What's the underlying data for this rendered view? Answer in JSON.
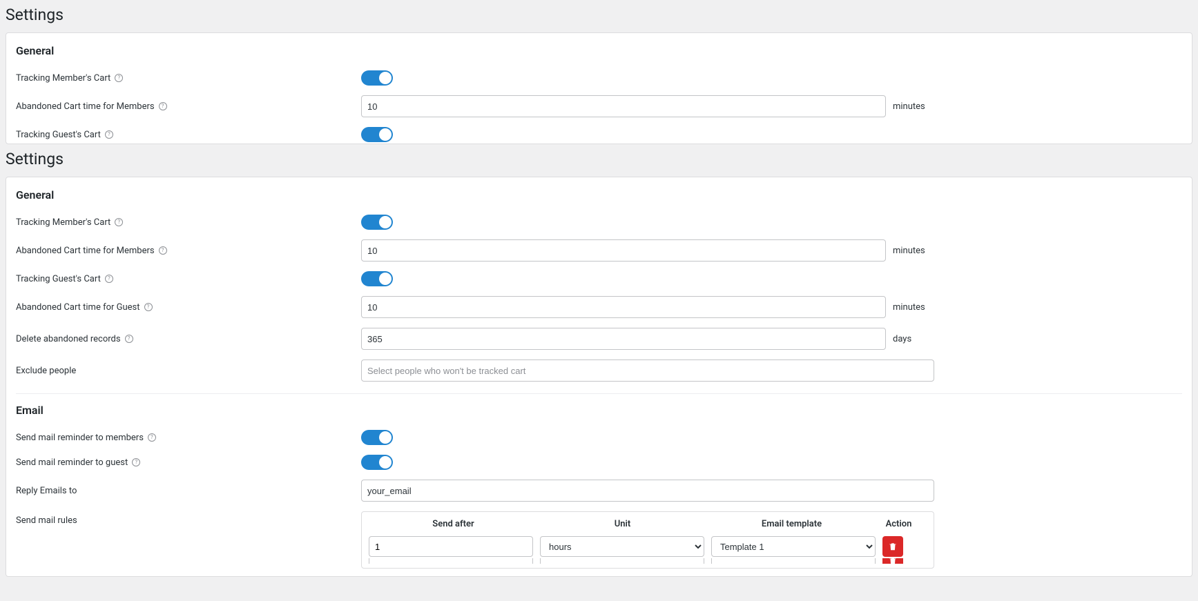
{
  "page_title": "Settings",
  "top": {
    "general_title": "General",
    "tracking_members_label": "Tracking Member's Cart",
    "abandoned_members_label": "Abandoned Cart time for Members",
    "abandoned_members_value": "10",
    "abandoned_members_unit": "minutes",
    "tracking_guest_label": "Tracking Guest's Cart"
  },
  "main": {
    "general_title": "General",
    "tracking_members_label": "Tracking Member's Cart",
    "abandoned_members_label": "Abandoned Cart time for Members",
    "abandoned_members_value": "10",
    "abandoned_members_unit": "minutes",
    "tracking_guest_label": "Tracking Guest's Cart",
    "abandoned_guest_label": "Abandoned Cart time for Guest",
    "abandoned_guest_value": "10",
    "abandoned_guest_unit": "minutes",
    "delete_records_label": "Delete abandoned records",
    "delete_records_value": "365",
    "delete_records_unit": "days",
    "exclude_label": "Exclude people",
    "exclude_placeholder": "Select people who won't be tracked cart"
  },
  "email": {
    "title": "Email",
    "send_members_label": "Send mail reminder to members",
    "send_guest_label": "Send mail reminder to guest",
    "reply_to_label": "Reply Emails to",
    "reply_to_value": "your_email",
    "rules_label": "Send mail rules",
    "headers": {
      "send_after": "Send after",
      "unit": "Unit",
      "template": "Email template",
      "action": "Action"
    },
    "rows": [
      {
        "send_after": "1",
        "unit": "hours",
        "template": "Template 1"
      }
    ],
    "unit_options": [
      "hours"
    ],
    "template_options": [
      "Template 1"
    ]
  }
}
